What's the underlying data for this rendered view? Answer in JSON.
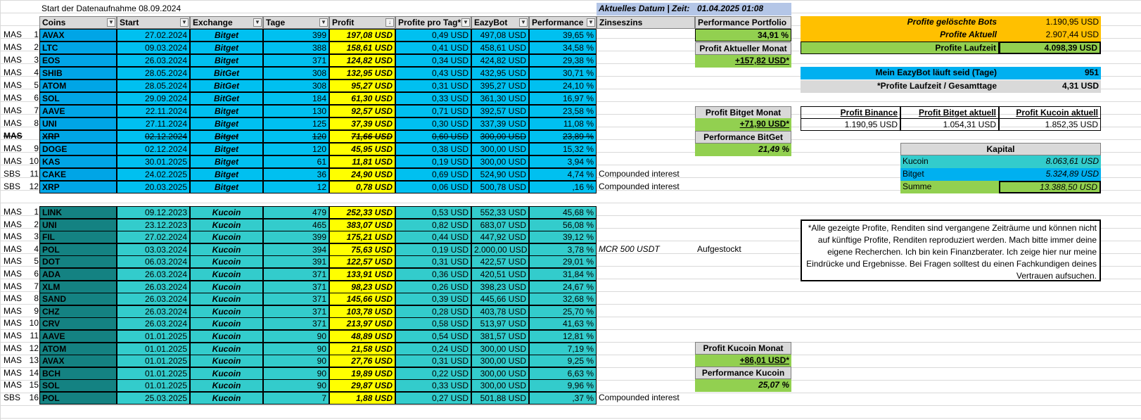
{
  "top": {
    "start_label": "Start der Datenaufnahme 08.09.2024",
    "date_label": "Aktuelles Datum | Zeit:",
    "date_value": "01.04.2025 01:08"
  },
  "headers": {
    "coins": "Coins",
    "start": "Start",
    "exchange": "Exchange",
    "tage": "Tage",
    "profit": "Profit",
    "pro_tag": "Profite pro Tag*",
    "eazybot": "EazyBot",
    "performance": "Performance",
    "zinseszins": "Zinseszins",
    "perf_portfolio": "Performance Portfolio"
  },
  "bitget_rows": [
    {
      "type": "MAS",
      "n": "1",
      "coin": "AVAX",
      "start": "27.02.2024",
      "ex": "Bitget",
      "tage": "399",
      "profit": "197,08 USD",
      "pt": "0,49 USD",
      "eb": "497,08 USD",
      "perf": "39,65 %",
      "note": ""
    },
    {
      "type": "MAS",
      "n": "2",
      "coin": "LTC",
      "start": "09.03.2024",
      "ex": "Bitget",
      "tage": "388",
      "profit": "158,61 USD",
      "pt": "0,41 USD",
      "eb": "458,61 USD",
      "perf": "34,58 %",
      "note": ""
    },
    {
      "type": "MAS",
      "n": "3",
      "coin": "EOS",
      "start": "26.03.2024",
      "ex": "Bitget",
      "tage": "371",
      "profit": "124,82 USD",
      "pt": "0,34 USD",
      "eb": "424,82 USD",
      "perf": "29,38 %",
      "note": ""
    },
    {
      "type": "MAS",
      "n": "4",
      "coin": "SHIB",
      "start": "28.05.2024",
      "ex": "BitGet",
      "tage": "308",
      "profit": "132,95 USD",
      "pt": "0,43 USD",
      "eb": "432,95 USD",
      "perf": "30,71 %",
      "note": ""
    },
    {
      "type": "MAS",
      "n": "5",
      "coin": "ATOM",
      "start": "28.05.2024",
      "ex": "BitGet",
      "tage": "308",
      "profit": "95,27 USD",
      "pt": "0,31 USD",
      "eb": "395,27 USD",
      "perf": "24,10 %",
      "note": ""
    },
    {
      "type": "MAS",
      "n": "6",
      "coin": "SOL",
      "start": "29.09.2024",
      "ex": "BitGet",
      "tage": "184",
      "profit": "61,30 USD",
      "pt": "0,33 USD",
      "eb": "361,30 USD",
      "perf": "16,97 %",
      "note": ""
    },
    {
      "type": "MAS",
      "n": "7",
      "coin": "AAVE",
      "start": "22.11.2024",
      "ex": "Bitget",
      "tage": "130",
      "profit": "92,57 USD",
      "pt": "0,71 USD",
      "eb": "392,57 USD",
      "perf": "23,58 %",
      "note": ""
    },
    {
      "type": "MAS",
      "n": "8",
      "coin": "UNI",
      "start": "27.11.2024",
      "ex": "Bitget",
      "tage": "125",
      "profit": "37,39 USD",
      "pt": "0,30 USD",
      "eb": "337,39 USD",
      "perf": "11,08 %",
      "note": ""
    },
    {
      "type": "MAS",
      "n": "",
      "coin": "XRP",
      "start": "02.12.2024",
      "ex": "Bitget",
      "tage": "120",
      "profit": "71,66 USD",
      "pt": "0,60 USD",
      "eb": "300,00 USD",
      "perf": "23,89 %",
      "note": "",
      "struck": true
    },
    {
      "type": "MAS",
      "n": "9",
      "coin": "DOGE",
      "start": "02.12.2024",
      "ex": "Bitget",
      "tage": "120",
      "profit": "45,95 USD",
      "pt": "0,38 USD",
      "eb": "300,00 USD",
      "perf": "15,32 %",
      "note": ""
    },
    {
      "type": "MAS",
      "n": "10",
      "coin": "KAS",
      "start": "30.01.2025",
      "ex": "Bitget",
      "tage": "61",
      "profit": "11,81 USD",
      "pt": "0,19 USD",
      "eb": "300,00 USD",
      "perf": "3,94 %",
      "note": ""
    },
    {
      "type": "SBS",
      "n": "11",
      "coin": "CAKE",
      "start": "24.02.2025",
      "ex": "Bitget",
      "tage": "36",
      "profit": "24,90 USD",
      "pt": "0,69 USD",
      "eb": "524,90 USD",
      "perf": "4,74 %",
      "note": "Compounded interest"
    },
    {
      "type": "SBS",
      "n": "12",
      "coin": "XRP",
      "start": "20.03.2025",
      "ex": "Bitget",
      "tage": "12",
      "profit": "0,78 USD",
      "pt": "0,06 USD",
      "eb": "500,78 USD",
      "perf": ",16 %",
      "note": "Compounded interest"
    }
  ],
  "kucoin_rows": [
    {
      "type": "MAS",
      "n": "1",
      "coin": "LINK",
      "start": "09.12.2023",
      "ex": "Kucoin",
      "tage": "479",
      "profit": "252,33 USD",
      "pt": "0,53 USD",
      "eb": "552,33 USD",
      "perf": "45,68 %",
      "note": ""
    },
    {
      "type": "MAS",
      "n": "2",
      "coin": "UNI",
      "start": "23.12.2023",
      "ex": "Kucoin",
      "tage": "465",
      "profit": "383,07 USD",
      "pt": "0,82 USD",
      "eb": "683,07 USD",
      "perf": "56,08 %",
      "note": ""
    },
    {
      "type": "MAS",
      "n": "3",
      "coin": "FIL",
      "start": "27.02.2024",
      "ex": "Kucoin",
      "tage": "399",
      "profit": "175,21 USD",
      "pt": "0,44 USD",
      "eb": "447,92 USD",
      "perf": "39,12 %",
      "note": ""
    },
    {
      "type": "MAS",
      "n": "4",
      "coin": "POL",
      "start": "03.03.2024",
      "ex": "Kucoin",
      "tage": "394",
      "profit": "75,63 USD",
      "pt": "0,19 USD",
      "eb": "2.000,00 USD",
      "perf": "3,78 %",
      "note": "MCR 500 USDT",
      "note2": "Aufgestockt"
    },
    {
      "type": "MAS",
      "n": "5",
      "coin": "DOT",
      "start": "06.03.2024",
      "ex": "Kucoin",
      "tage": "391",
      "profit": "122,57 USD",
      "pt": "0,31 USD",
      "eb": "422,57 USD",
      "perf": "29,01 %",
      "note": ""
    },
    {
      "type": "MAS",
      "n": "6",
      "coin": "ADA",
      "start": "26.03.2024",
      "ex": "Kucoin",
      "tage": "371",
      "profit": "133,91 USD",
      "pt": "0,36 USD",
      "eb": "420,51 USD",
      "perf": "31,84 %",
      "note": ""
    },
    {
      "type": "MAS",
      "n": "7",
      "coin": "XLM",
      "start": "26.03.2024",
      "ex": "Kucoin",
      "tage": "371",
      "profit": "98,23 USD",
      "pt": "0,26 USD",
      "eb": "398,23 USD",
      "perf": "24,67 %",
      "note": ""
    },
    {
      "type": "MAS",
      "n": "8",
      "coin": "SAND",
      "start": "26.03.2024",
      "ex": "Kucoin",
      "tage": "371",
      "profit": "145,66 USD",
      "pt": "0,39 USD",
      "eb": "445,66 USD",
      "perf": "32,68 %",
      "note": ""
    },
    {
      "type": "MAS",
      "n": "9",
      "coin": "CHZ",
      "start": "26.03.2024",
      "ex": "Kucoin",
      "tage": "371",
      "profit": "103,78 USD",
      "pt": "0,28 USD",
      "eb": "403,78 USD",
      "perf": "25,70 %",
      "note": ""
    },
    {
      "type": "MAS",
      "n": "10",
      "coin": "CRV",
      "start": "26.03.2024",
      "ex": "Kucoin",
      "tage": "371",
      "profit": "213,97 USD",
      "pt": "0,58 USD",
      "eb": "513,97 USD",
      "perf": "41,63 %",
      "note": ""
    },
    {
      "type": "MAS",
      "n": "11",
      "coin": "AAVE",
      "start": "01.01.2025",
      "ex": "Kucoin",
      "tage": "90",
      "profit": "48,89 USD",
      "pt": "0,54 USD",
      "eb": "381,57 USD",
      "perf": "12,81 %",
      "note": ""
    },
    {
      "type": "MAS",
      "n": "12",
      "coin": "ATOM",
      "start": "01.01.2025",
      "ex": "Kucoin",
      "tage": "90",
      "profit": "21,58 USD",
      "pt": "0,24 USD",
      "eb": "300,00 USD",
      "perf": "7,19 %",
      "note": ""
    },
    {
      "type": "MAS",
      "n": "13",
      "coin": "AVAX",
      "start": "01.01.2025",
      "ex": "Kucoin",
      "tage": "90",
      "profit": "27,76 USD",
      "pt": "0,31 USD",
      "eb": "300,00 USD",
      "perf": "9,25 %",
      "note": ""
    },
    {
      "type": "MAS",
      "n": "14",
      "coin": "BCH",
      "start": "01.01.2025",
      "ex": "Kucoin",
      "tage": "90",
      "profit": "19,89 USD",
      "pt": "0,22 USD",
      "eb": "300,00 USD",
      "perf": "6,63 %",
      "note": ""
    },
    {
      "type": "MAS",
      "n": "15",
      "coin": "SOL",
      "start": "01.01.2025",
      "ex": "Kucoin",
      "tage": "90",
      "profit": "29,87 USD",
      "pt": "0,33 USD",
      "eb": "300,00 USD",
      "perf": "9,96 %",
      "note": ""
    },
    {
      "type": "SBS",
      "n": "16",
      "coin": "POL",
      "start": "25.03.2025",
      "ex": "Kucoin",
      "tage": "7",
      "profit": "1,88 USD",
      "pt": "0,27 USD",
      "eb": "501,88 USD",
      "perf": ",37 %",
      "note": "Compounded interest"
    }
  ],
  "portfolio": {
    "perf_value": "34,91 %",
    "monat_label": "Profit Aktueller Monat",
    "monat_value": "+157,82 USD*",
    "bitget_monat_label": "Profit Bitget Monat",
    "bitget_monat_value": "+71,90 USD*",
    "bitget_perf_label": "Performance BitGet",
    "bitget_perf_value": "21,49 %",
    "kucoin_monat_label": "Profit Kucoin Monat",
    "kucoin_monat_value": "+86,01 USD*",
    "kucoin_perf_label": "Performance Kucoin",
    "kucoin_perf_value": "25,07 %"
  },
  "summary": {
    "geloescht_label": "Profite gelöschte Bots",
    "geloescht_value": "1.190,95 USD",
    "aktuell_label": "Profite Aktuell",
    "aktuell_value": "2.907,44 USD",
    "laufzeit_label": "Profite Laufzeit",
    "laufzeit_value": "4.098,39 USD",
    "tage_label": "Mein EazyBot läuft seid (Tage)",
    "tage_value": "951",
    "ratio_label": "*Profite Laufzeit  / Gesamttage",
    "ratio_value": "4,31 USD",
    "binance_label": "Profit Binance",
    "binance_value": "1.190,95 USD",
    "bitget_label": "Profit Bitget aktuell",
    "bitget_value": "1.054,31 USD",
    "kucoin_label": "Profit Kucoin aktuell",
    "kucoin_value": "1.852,35 USD",
    "kapital_label": "Kapital",
    "k_kucoin_label": "Kucoin",
    "k_kucoin_value": "8.063,61 USD",
    "k_bitget_label": "Bitget",
    "k_bitget_value": "5.324,89 USD",
    "k_summe_label": "Summe",
    "k_summe_value": "13.388,50 USD"
  },
  "disclaimer": "*Alle gezeigte Profite, Renditen sind vergangene Zeiträume und können nicht auf künftige Profite, Renditen reproduziert werden. Mach bitte immer deine eigene Recherchen. Ich bin kein Finanzberater. Ich zeige hier nur meine Eindrücke und Ergebnisse. Bei Fragen solltest du einen Fachkundigen deines Vertrauen aufsuchen.",
  "colors": {
    "bitget": "#00c0f0",
    "kucoin": "#33cccc",
    "profit": "#ffff00",
    "green": "#92d050",
    "orange": "#ffc000"
  }
}
